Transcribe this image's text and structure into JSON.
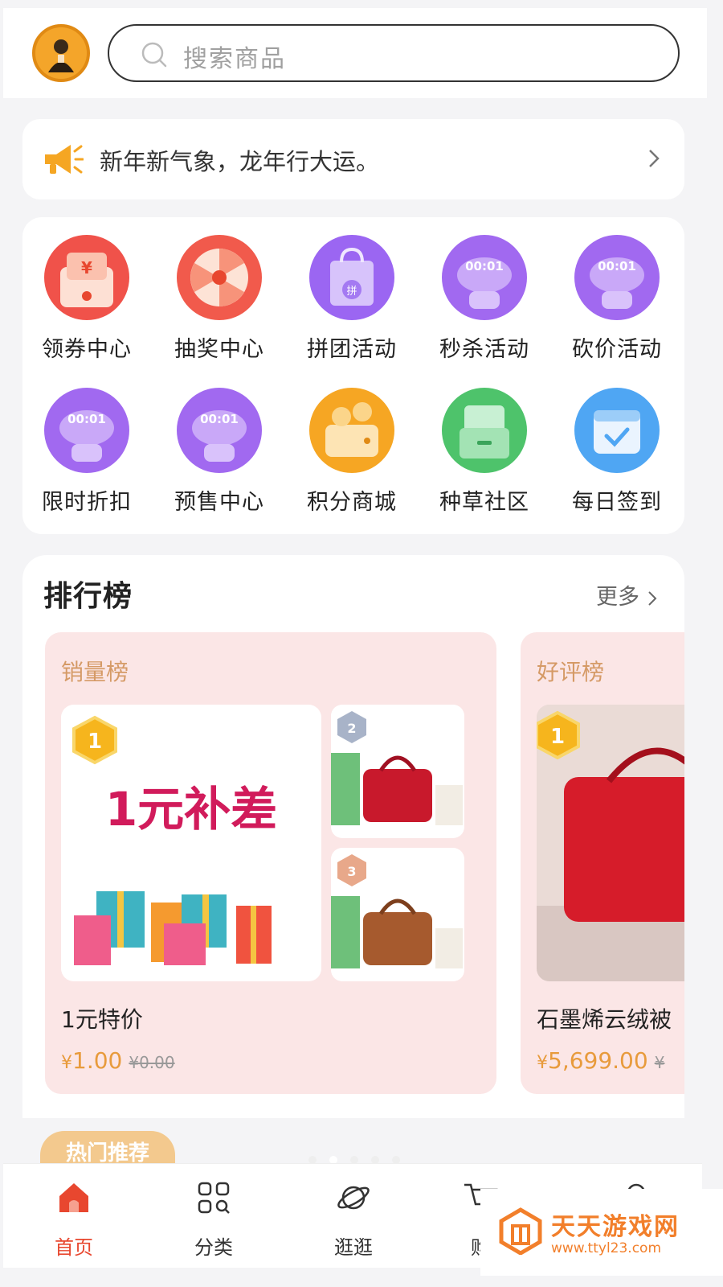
{
  "header": {
    "search_placeholder": "搜索商品"
  },
  "notice": {
    "text": "新年新气象，龙年行大运。"
  },
  "grid": {
    "items": [
      {
        "label": "领券中心",
        "icon": "coupon-icon"
      },
      {
        "label": "抽奖中心",
        "icon": "lottery-wheel-icon"
      },
      {
        "label": "拼团活动",
        "icon": "group-buy-bag-icon"
      },
      {
        "label": "秒杀活动",
        "icon": "flash-sale-timer-icon"
      },
      {
        "label": "砍价活动",
        "icon": "bargain-timer-icon"
      },
      {
        "label": "限时折扣",
        "icon": "discount-timer-icon"
      },
      {
        "label": "预售中心",
        "icon": "presale-timer-icon"
      },
      {
        "label": "积分商城",
        "icon": "points-wallet-icon"
      },
      {
        "label": "种草社区",
        "icon": "community-folder-icon"
      },
      {
        "label": "每日签到",
        "icon": "calendar-checkin-icon"
      }
    ],
    "timer_text": "00:01",
    "coupon_glyph": "¥",
    "group_glyph": "拼"
  },
  "ranking": {
    "title": "排行榜",
    "more_label": "更多",
    "panels": [
      {
        "title": "销量榜",
        "product_name": "1元特价",
        "price_symbol": "¥",
        "price": "1.00",
        "old_price": "¥0.00",
        "rank_badge": "1",
        "promo_text": "1元补差",
        "thumb_badges": [
          "2",
          "3"
        ]
      },
      {
        "title": "好评榜",
        "product_name": "石墨烯云绒被",
        "price_symbol": "¥",
        "price": "5,699.00",
        "old_price": "¥",
        "rank_badge": "1"
      }
    ]
  },
  "hot": {
    "label": "热门推荐"
  },
  "tabbar": {
    "tabs": [
      {
        "label": "首页",
        "icon": "home-icon",
        "active": true
      },
      {
        "label": "分类",
        "icon": "category-grid-icon",
        "active": false
      },
      {
        "label": "逛逛",
        "icon": "planet-icon",
        "active": false
      },
      {
        "label": "购",
        "icon": "cart-icon",
        "active": false
      },
      {
        "label": "",
        "icon": "user-icon",
        "active": false
      }
    ]
  },
  "watermark": {
    "name": "天天游戏网",
    "url": "www.ttyl23.com"
  },
  "colors": {
    "accent": "#e8472f",
    "price": "#e89b3c",
    "panel_bg": "#fbe6e6",
    "panel_title": "#d59a66"
  }
}
